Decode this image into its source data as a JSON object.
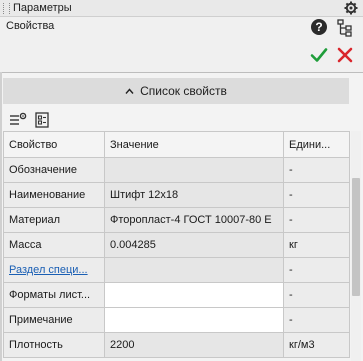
{
  "window": {
    "title": "Параметры"
  },
  "header": {
    "subtitle": "Свойства"
  },
  "section": {
    "label": "Список свойств"
  },
  "table": {
    "columns": [
      "Свойство",
      "Значение",
      "Едини..."
    ],
    "rows": [
      {
        "name": "Обозначение",
        "value": "",
        "unit": "-"
      },
      {
        "name": "Наименование",
        "value": "Штифт 12x18",
        "unit": "-"
      },
      {
        "name": "Материал",
        "value": "Фторопласт-4 ГОСТ 10007-80 E",
        "unit": "-"
      },
      {
        "name": "Масса",
        "value": "0.004285",
        "unit": "кг"
      },
      {
        "name": "Раздел специ...",
        "value": "",
        "unit": "-"
      },
      {
        "name": "Форматы лист...",
        "value": "",
        "unit": "-"
      },
      {
        "name": "Примечание",
        "value": "",
        "unit": "-"
      },
      {
        "name": "Плотность",
        "value": "2200",
        "unit": "кг/м3"
      }
    ]
  },
  "icons": {
    "settings": "gear-icon",
    "help": "question-icon",
    "tree": "tree-structure-icon",
    "ok": "checkmark-icon",
    "cancel": "close-icon",
    "collapse": "chevron-up-icon",
    "add_property": "add-property-icon",
    "property_sheet": "property-sheet-icon"
  },
  "colors": {
    "ok": "#1f9d3a",
    "cancel": "#d9262c",
    "link": "#1a5fb4"
  }
}
